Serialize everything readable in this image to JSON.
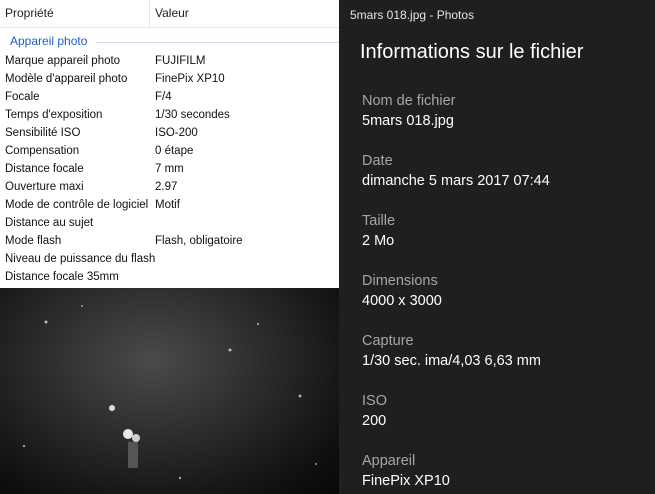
{
  "properties_panel": {
    "columns": {
      "property": "Propriété",
      "value": "Valeur"
    },
    "group_title": "Appareil photo",
    "rows": [
      {
        "key": "Marque appareil photo",
        "value": "FUJIFILM"
      },
      {
        "key": "Modèle d'appareil photo",
        "value": "FinePix XP10"
      },
      {
        "key": "Focale",
        "value": "F/4"
      },
      {
        "key": "Temps d'exposition",
        "value": "1/30 secondes"
      },
      {
        "key": "Sensibilité ISO",
        "value": "ISO-200"
      },
      {
        "key": "Compensation",
        "value": "0 étape"
      },
      {
        "key": "Distance focale",
        "value": "7 mm"
      },
      {
        "key": "Ouverture maxi",
        "value": "2.97"
      },
      {
        "key": "Mode de contrôle de logiciel",
        "value": "Motif"
      },
      {
        "key": "Distance au sujet",
        "value": ""
      },
      {
        "key": "Mode flash",
        "value": "Flash, obligatoire"
      },
      {
        "key": "Niveau de puissance du flash",
        "value": ""
      },
      {
        "key": "Distance focale 35mm",
        "value": ""
      }
    ]
  },
  "photos_panel": {
    "window_title": "5mars 018.jpg - Photos",
    "heading": "Informations sur le fichier",
    "fields": [
      {
        "label": "Nom de fichier",
        "value": "5mars 018.jpg"
      },
      {
        "label": "Date",
        "value": "dimanche 5 mars 2017 07:44"
      },
      {
        "label": "Taille",
        "value": "2 Mo"
      },
      {
        "label": "Dimensions",
        "value": "4000 x 3000"
      },
      {
        "label": "Capture",
        "value": "1/30 sec. ima/4,03 6,63 mm"
      },
      {
        "label": "ISO",
        "value": "200"
      },
      {
        "label": "Appareil",
        "value": "FinePix XP10"
      }
    ]
  }
}
